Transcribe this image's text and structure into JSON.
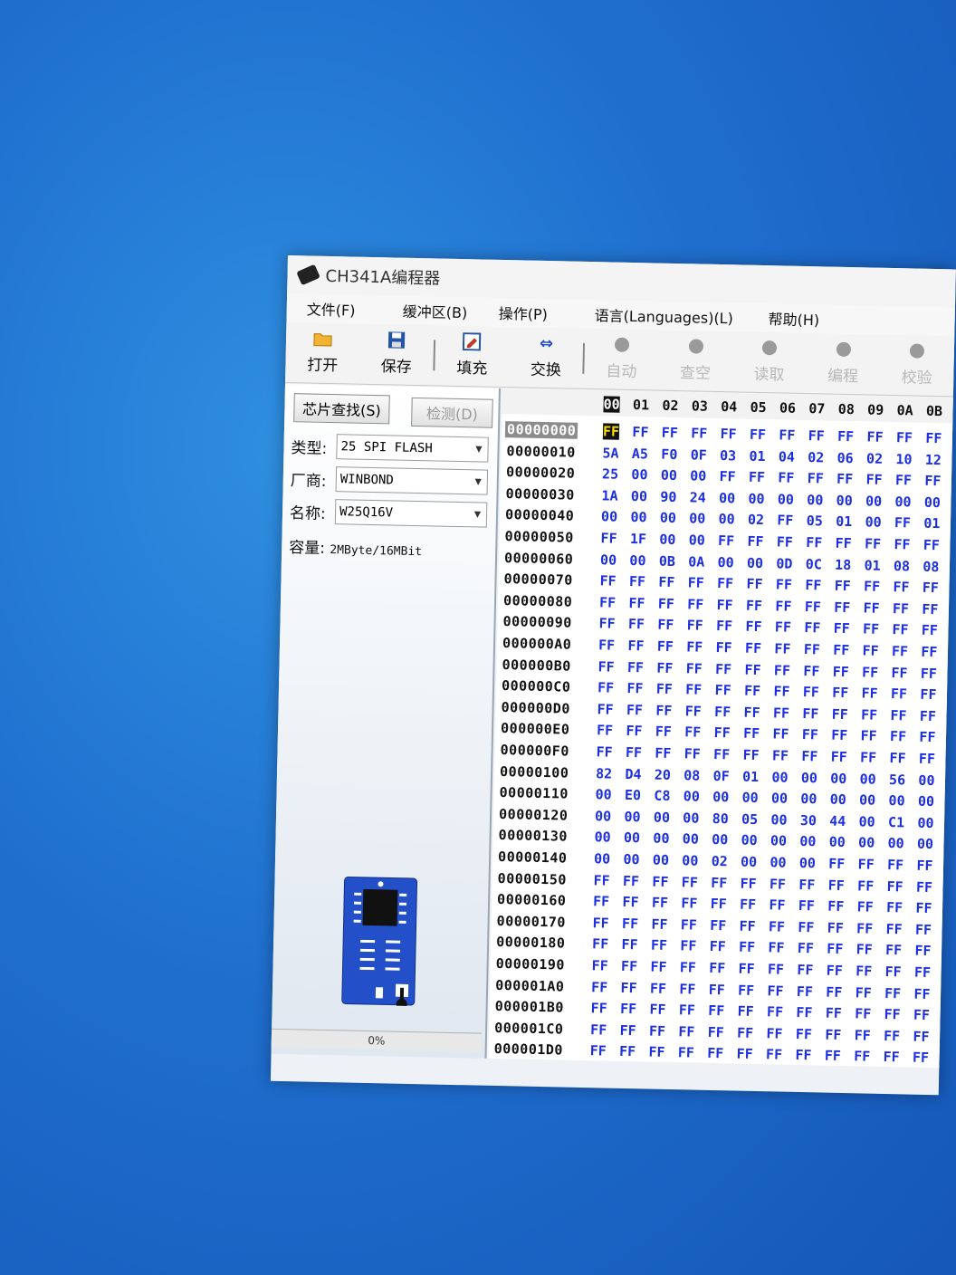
{
  "window": {
    "title": "CH341A编程器"
  },
  "menu": [
    "文件(F)",
    "缓冲区(B)",
    "操作(P)",
    "语言(Languages)(L)",
    "帮助(H)"
  ],
  "toolbar": [
    {
      "label": "打开",
      "icon": "folder-open-icon",
      "enabled": true
    },
    {
      "label": "保存",
      "icon": "save-icon",
      "enabled": true
    },
    {
      "label": "填充",
      "icon": "fill-icon",
      "enabled": true
    },
    {
      "label": "交换",
      "icon": "swap-icon",
      "enabled": true
    },
    {
      "label": "自动",
      "icon": "auto-icon",
      "enabled": false
    },
    {
      "label": "查空",
      "icon": "blank-check-icon",
      "enabled": false
    },
    {
      "label": "读取",
      "icon": "read-icon",
      "enabled": false
    },
    {
      "label": "编程",
      "icon": "program-icon",
      "enabled": false
    },
    {
      "label": "校验",
      "icon": "verify-icon",
      "enabled": false
    }
  ],
  "left_panel": {
    "chip_search_label": "芯片查找(S)",
    "detect_label": "检测(D)",
    "type_label": "类型:",
    "type_value": "25 SPI FLASH",
    "vendor_label": "厂商:",
    "vendor_value": "WINBOND",
    "name_label": "名称:",
    "name_value": "W25Q16V",
    "capacity_label": "容量:",
    "capacity_value": "2MByte/16MBit",
    "progress_text": "0%"
  },
  "hex": {
    "columns": [
      "00",
      "01",
      "02",
      "03",
      "04",
      "05",
      "06",
      "07",
      "08",
      "09",
      "0A",
      "0B"
    ],
    "selected_row": 0,
    "cursor": [
      0,
      0
    ],
    "rows": [
      {
        "addr": "00000000",
        "bytes": [
          "FF",
          "FF",
          "FF",
          "FF",
          "FF",
          "FF",
          "FF",
          "FF",
          "FF",
          "FF",
          "FF",
          "FF"
        ]
      },
      {
        "addr": "00000010",
        "bytes": [
          "5A",
          "A5",
          "F0",
          "0F",
          "03",
          "01",
          "04",
          "02",
          "06",
          "02",
          "10",
          "12"
        ]
      },
      {
        "addr": "00000020",
        "bytes": [
          "25",
          "00",
          "00",
          "00",
          "FF",
          "FF",
          "FF",
          "FF",
          "FF",
          "FF",
          "FF",
          "FF"
        ]
      },
      {
        "addr": "00000030",
        "bytes": [
          "1A",
          "00",
          "90",
          "24",
          "00",
          "00",
          "00",
          "00",
          "00",
          "00",
          "00",
          "00"
        ]
      },
      {
        "addr": "00000040",
        "bytes": [
          "00",
          "00",
          "00",
          "00",
          "00",
          "02",
          "FF",
          "05",
          "01",
          "00",
          "FF",
          "01"
        ]
      },
      {
        "addr": "00000050",
        "bytes": [
          "FF",
          "1F",
          "00",
          "00",
          "FF",
          "FF",
          "FF",
          "FF",
          "FF",
          "FF",
          "FF",
          "FF"
        ]
      },
      {
        "addr": "00000060",
        "bytes": [
          "00",
          "00",
          "0B",
          "0A",
          "00",
          "00",
          "0D",
          "0C",
          "18",
          "01",
          "08",
          "08"
        ]
      },
      {
        "addr": "00000070",
        "bytes": [
          "FF",
          "FF",
          "FF",
          "FF",
          "FF",
          "FF",
          "FF",
          "FF",
          "FF",
          "FF",
          "FF",
          "FF"
        ]
      },
      {
        "addr": "00000080",
        "bytes": [
          "FF",
          "FF",
          "FF",
          "FF",
          "FF",
          "FF",
          "FF",
          "FF",
          "FF",
          "FF",
          "FF",
          "FF"
        ]
      },
      {
        "addr": "00000090",
        "bytes": [
          "FF",
          "FF",
          "FF",
          "FF",
          "FF",
          "FF",
          "FF",
          "FF",
          "FF",
          "FF",
          "FF",
          "FF"
        ]
      },
      {
        "addr": "000000A0",
        "bytes": [
          "FF",
          "FF",
          "FF",
          "FF",
          "FF",
          "FF",
          "FF",
          "FF",
          "FF",
          "FF",
          "FF",
          "FF"
        ]
      },
      {
        "addr": "000000B0",
        "bytes": [
          "FF",
          "FF",
          "FF",
          "FF",
          "FF",
          "FF",
          "FF",
          "FF",
          "FF",
          "FF",
          "FF",
          "FF"
        ]
      },
      {
        "addr": "000000C0",
        "bytes": [
          "FF",
          "FF",
          "FF",
          "FF",
          "FF",
          "FF",
          "FF",
          "FF",
          "FF",
          "FF",
          "FF",
          "FF"
        ]
      },
      {
        "addr": "000000D0",
        "bytes": [
          "FF",
          "FF",
          "FF",
          "FF",
          "FF",
          "FF",
          "FF",
          "FF",
          "FF",
          "FF",
          "FF",
          "FF"
        ]
      },
      {
        "addr": "000000E0",
        "bytes": [
          "FF",
          "FF",
          "FF",
          "FF",
          "FF",
          "FF",
          "FF",
          "FF",
          "FF",
          "FF",
          "FF",
          "FF"
        ]
      },
      {
        "addr": "000000F0",
        "bytes": [
          "FF",
          "FF",
          "FF",
          "FF",
          "FF",
          "FF",
          "FF",
          "FF",
          "FF",
          "FF",
          "FF",
          "FF"
        ]
      },
      {
        "addr": "00000100",
        "bytes": [
          "82",
          "D4",
          "20",
          "08",
          "0F",
          "01",
          "00",
          "00",
          "00",
          "00",
          "56",
          "00"
        ]
      },
      {
        "addr": "00000110",
        "bytes": [
          "00",
          "E0",
          "C8",
          "00",
          "00",
          "00",
          "00",
          "00",
          "00",
          "00",
          "00",
          "00"
        ]
      },
      {
        "addr": "00000120",
        "bytes": [
          "00",
          "00",
          "00",
          "00",
          "80",
          "05",
          "00",
          "30",
          "44",
          "00",
          "C1",
          "00"
        ]
      },
      {
        "addr": "00000130",
        "bytes": [
          "00",
          "00",
          "00",
          "00",
          "00",
          "00",
          "00",
          "00",
          "00",
          "00",
          "00",
          "00"
        ]
      },
      {
        "addr": "00000140",
        "bytes": [
          "00",
          "00",
          "00",
          "00",
          "02",
          "00",
          "00",
          "00",
          "FF",
          "FF",
          "FF",
          "FF"
        ]
      },
      {
        "addr": "00000150",
        "bytes": [
          "FF",
          "FF",
          "FF",
          "FF",
          "FF",
          "FF",
          "FF",
          "FF",
          "FF",
          "FF",
          "FF",
          "FF"
        ]
      },
      {
        "addr": "00000160",
        "bytes": [
          "FF",
          "FF",
          "FF",
          "FF",
          "FF",
          "FF",
          "FF",
          "FF",
          "FF",
          "FF",
          "FF",
          "FF"
        ]
      },
      {
        "addr": "00000170",
        "bytes": [
          "FF",
          "FF",
          "FF",
          "FF",
          "FF",
          "FF",
          "FF",
          "FF",
          "FF",
          "FF",
          "FF",
          "FF"
        ]
      },
      {
        "addr": "00000180",
        "bytes": [
          "FF",
          "FF",
          "FF",
          "FF",
          "FF",
          "FF",
          "FF",
          "FF",
          "FF",
          "FF",
          "FF",
          "FF"
        ]
      },
      {
        "addr": "00000190",
        "bytes": [
          "FF",
          "FF",
          "FF",
          "FF",
          "FF",
          "FF",
          "FF",
          "FF",
          "FF",
          "FF",
          "FF",
          "FF"
        ]
      },
      {
        "addr": "000001A0",
        "bytes": [
          "FF",
          "FF",
          "FF",
          "FF",
          "FF",
          "FF",
          "FF",
          "FF",
          "FF",
          "FF",
          "FF",
          "FF"
        ]
      },
      {
        "addr": "000001B0",
        "bytes": [
          "FF",
          "FF",
          "FF",
          "FF",
          "FF",
          "FF",
          "FF",
          "FF",
          "FF",
          "FF",
          "FF",
          "FF"
        ]
      },
      {
        "addr": "000001C0",
        "bytes": [
          "FF",
          "FF",
          "FF",
          "FF",
          "FF",
          "FF",
          "FF",
          "FF",
          "FF",
          "FF",
          "FF",
          "FF"
        ]
      },
      {
        "addr": "000001D0",
        "bytes": [
          "FF",
          "FF",
          "FF",
          "FF",
          "FF",
          "FF",
          "FF",
          "FF",
          "FF",
          "FF",
          "FF",
          "FF"
        ]
      }
    ]
  },
  "colors": {
    "byte_text": "#1b2ee0",
    "desktop": "#1f6fcf",
    "disabled_tool": "#b8b8b8"
  }
}
